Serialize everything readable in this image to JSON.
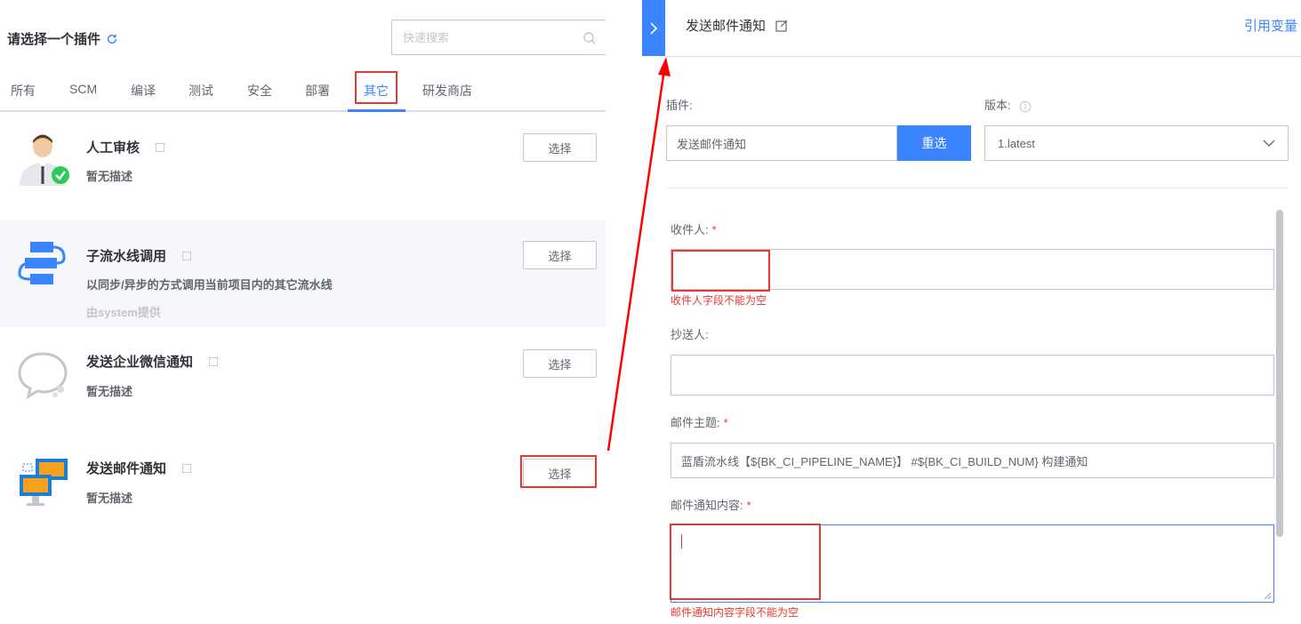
{
  "left": {
    "title": "请选择一个插件",
    "search_placeholder": "快速搜索",
    "tabs": [
      {
        "label": "所有"
      },
      {
        "label": "SCM"
      },
      {
        "label": "编译"
      },
      {
        "label": "测试"
      },
      {
        "label": "安全"
      },
      {
        "label": "部署"
      },
      {
        "label": "其它",
        "active": true
      },
      {
        "label": "研发商店"
      }
    ],
    "plugins": [
      {
        "name": "人工审核",
        "desc": "暂无描述",
        "button": "选择",
        "icon": "manual-review-icon"
      },
      {
        "name": "子流水线调用",
        "desc": "以同步/异步的方式调用当前项目内的其它流水线",
        "provider": "由system提供",
        "button": "选择",
        "icon": "sub-pipeline-icon"
      },
      {
        "name": "发送企业微信通知",
        "desc": "暂无描述",
        "button": "选择",
        "icon": "wechat-work-icon"
      },
      {
        "name": "发送邮件通知",
        "desc": "暂无描述",
        "button": "选择",
        "icon": "email-notify-icon"
      }
    ]
  },
  "right": {
    "title": "发送邮件通知",
    "ref_var": "引用变量",
    "plugin_label": "插件:",
    "plugin_value": "发送邮件通知",
    "reselect": "重选",
    "version_label": "版本:",
    "version_value": "1.latest",
    "receiver_label": "收件人:",
    "receiver_value": "",
    "receiver_error": "收件人字段不能为空",
    "cc_label": "抄送人:",
    "cc_value": "",
    "subject_label": "邮件主题:",
    "subject_value": "蓝盾流水线【${BK_CI_PIPELINE_NAME}】 #${BK_CI_BUILD_NUM} 构建通知",
    "content_label": "邮件通知内容:",
    "content_value": "",
    "content_error": "邮件通知内容字段不能为空",
    "required_mark": "*"
  },
  "colors": {
    "primary": "#3a84ff",
    "error": "#ea3636",
    "annotation": "#ff0000"
  }
}
